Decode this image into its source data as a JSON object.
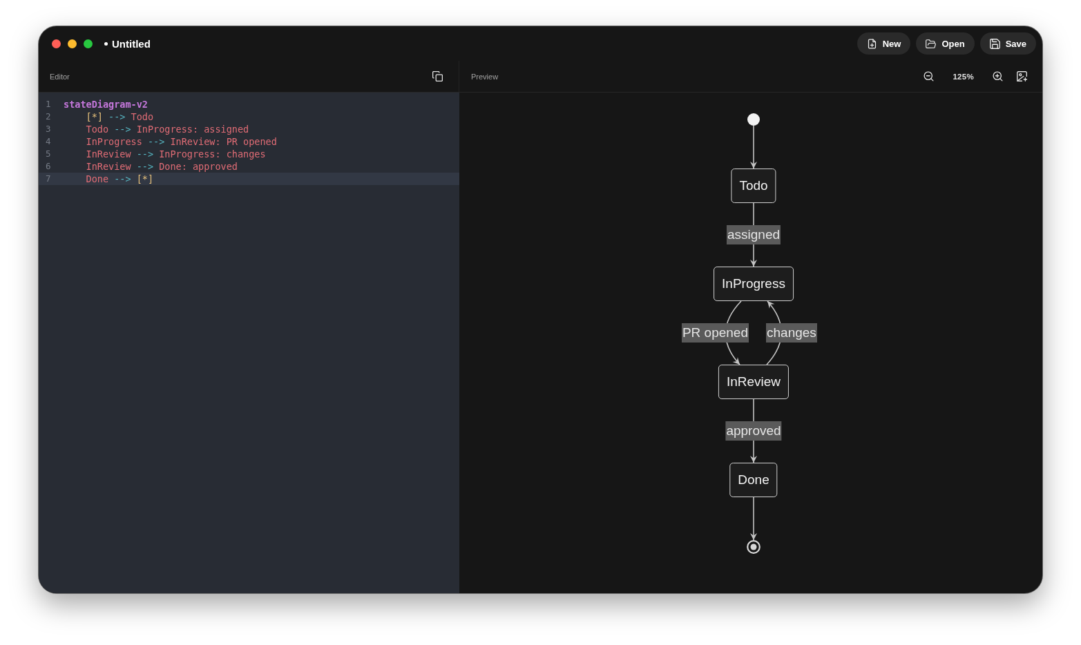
{
  "window": {
    "title": "Untitled",
    "modified": true,
    "traffic_lights": [
      {
        "color": "#ff5f57"
      },
      {
        "color": "#febc2e"
      },
      {
        "color": "#28c840"
      }
    ]
  },
  "toolbar": {
    "buttons": [
      {
        "kind": "new",
        "label": "New"
      },
      {
        "kind": "open",
        "label": "Open"
      },
      {
        "kind": "save",
        "label": "Save"
      }
    ]
  },
  "editor": {
    "title": "Editor",
    "lines": [
      {
        "number": "1",
        "active": false,
        "tokens": [
          {
            "kind": "keyword",
            "text": "stateDiagram-v2"
          }
        ],
        "children": [
          {
            "number": "2",
            "active": false,
            "tokens": [
              {
                "kind": "marker",
                "text": "[*] "
              },
              {
                "kind": "arrow",
                "text": "--> "
              },
              {
                "kind": "state",
                "text": "Todo"
              }
            ]
          },
          {
            "number": "3",
            "active": false,
            "tokens": [
              {
                "kind": "state",
                "text": "Todo "
              },
              {
                "kind": "arrow",
                "text": "--> "
              },
              {
                "kind": "state",
                "text": "InProgress: assigned"
              }
            ]
          },
          {
            "number": "4",
            "active": false,
            "tokens": [
              {
                "kind": "state",
                "text": "InProgress "
              },
              {
                "kind": "arrow",
                "text": "--> "
              },
              {
                "kind": "state",
                "text": "InReview: PR opened"
              }
            ]
          },
          {
            "number": "5",
            "active": false,
            "tokens": [
              {
                "kind": "state",
                "text": "InReview "
              },
              {
                "kind": "arrow",
                "text": "--> "
              },
              {
                "kind": "state",
                "text": "InProgress: changes"
              }
            ]
          },
          {
            "number": "6",
            "active": false,
            "tokens": [
              {
                "kind": "state",
                "text": "InReview "
              },
              {
                "kind": "arrow",
                "text": "--> "
              },
              {
                "kind": "state",
                "text": "Done: approved"
              }
            ]
          },
          {
            "number": "7",
            "active": true,
            "tokens": [
              {
                "kind": "state",
                "text": "Done "
              },
              {
                "kind": "arrow",
                "text": "--> "
              },
              {
                "kind": "marker",
                "text": "[*]"
              }
            ]
          }
        ]
      }
    ]
  },
  "preview": {
    "title": "Preview",
    "zoom": "125%",
    "diagram": {
      "nodes": [
        {
          "kind": "start",
          "arrow_down": true,
          "arrow_up": false
        },
        {
          "kind": "state",
          "label": "Todo",
          "arrow_down": true,
          "down_label": "assigned",
          "arrow_up": false
        },
        {
          "kind": "state",
          "label": "InProgress",
          "arrow_down": true,
          "down_label": "PR opened",
          "arrow_up": false
        },
        {
          "kind": "state",
          "label": "InReview",
          "arrow_down": true,
          "down_label": "approved",
          "arrow_up": true,
          "up_label": "changes"
        },
        {
          "kind": "state",
          "label": "Done",
          "arrow_down": true,
          "arrow_up": false
        },
        {
          "kind": "end",
          "arrow_down": false,
          "arrow_up": false
        }
      ]
    }
  }
}
